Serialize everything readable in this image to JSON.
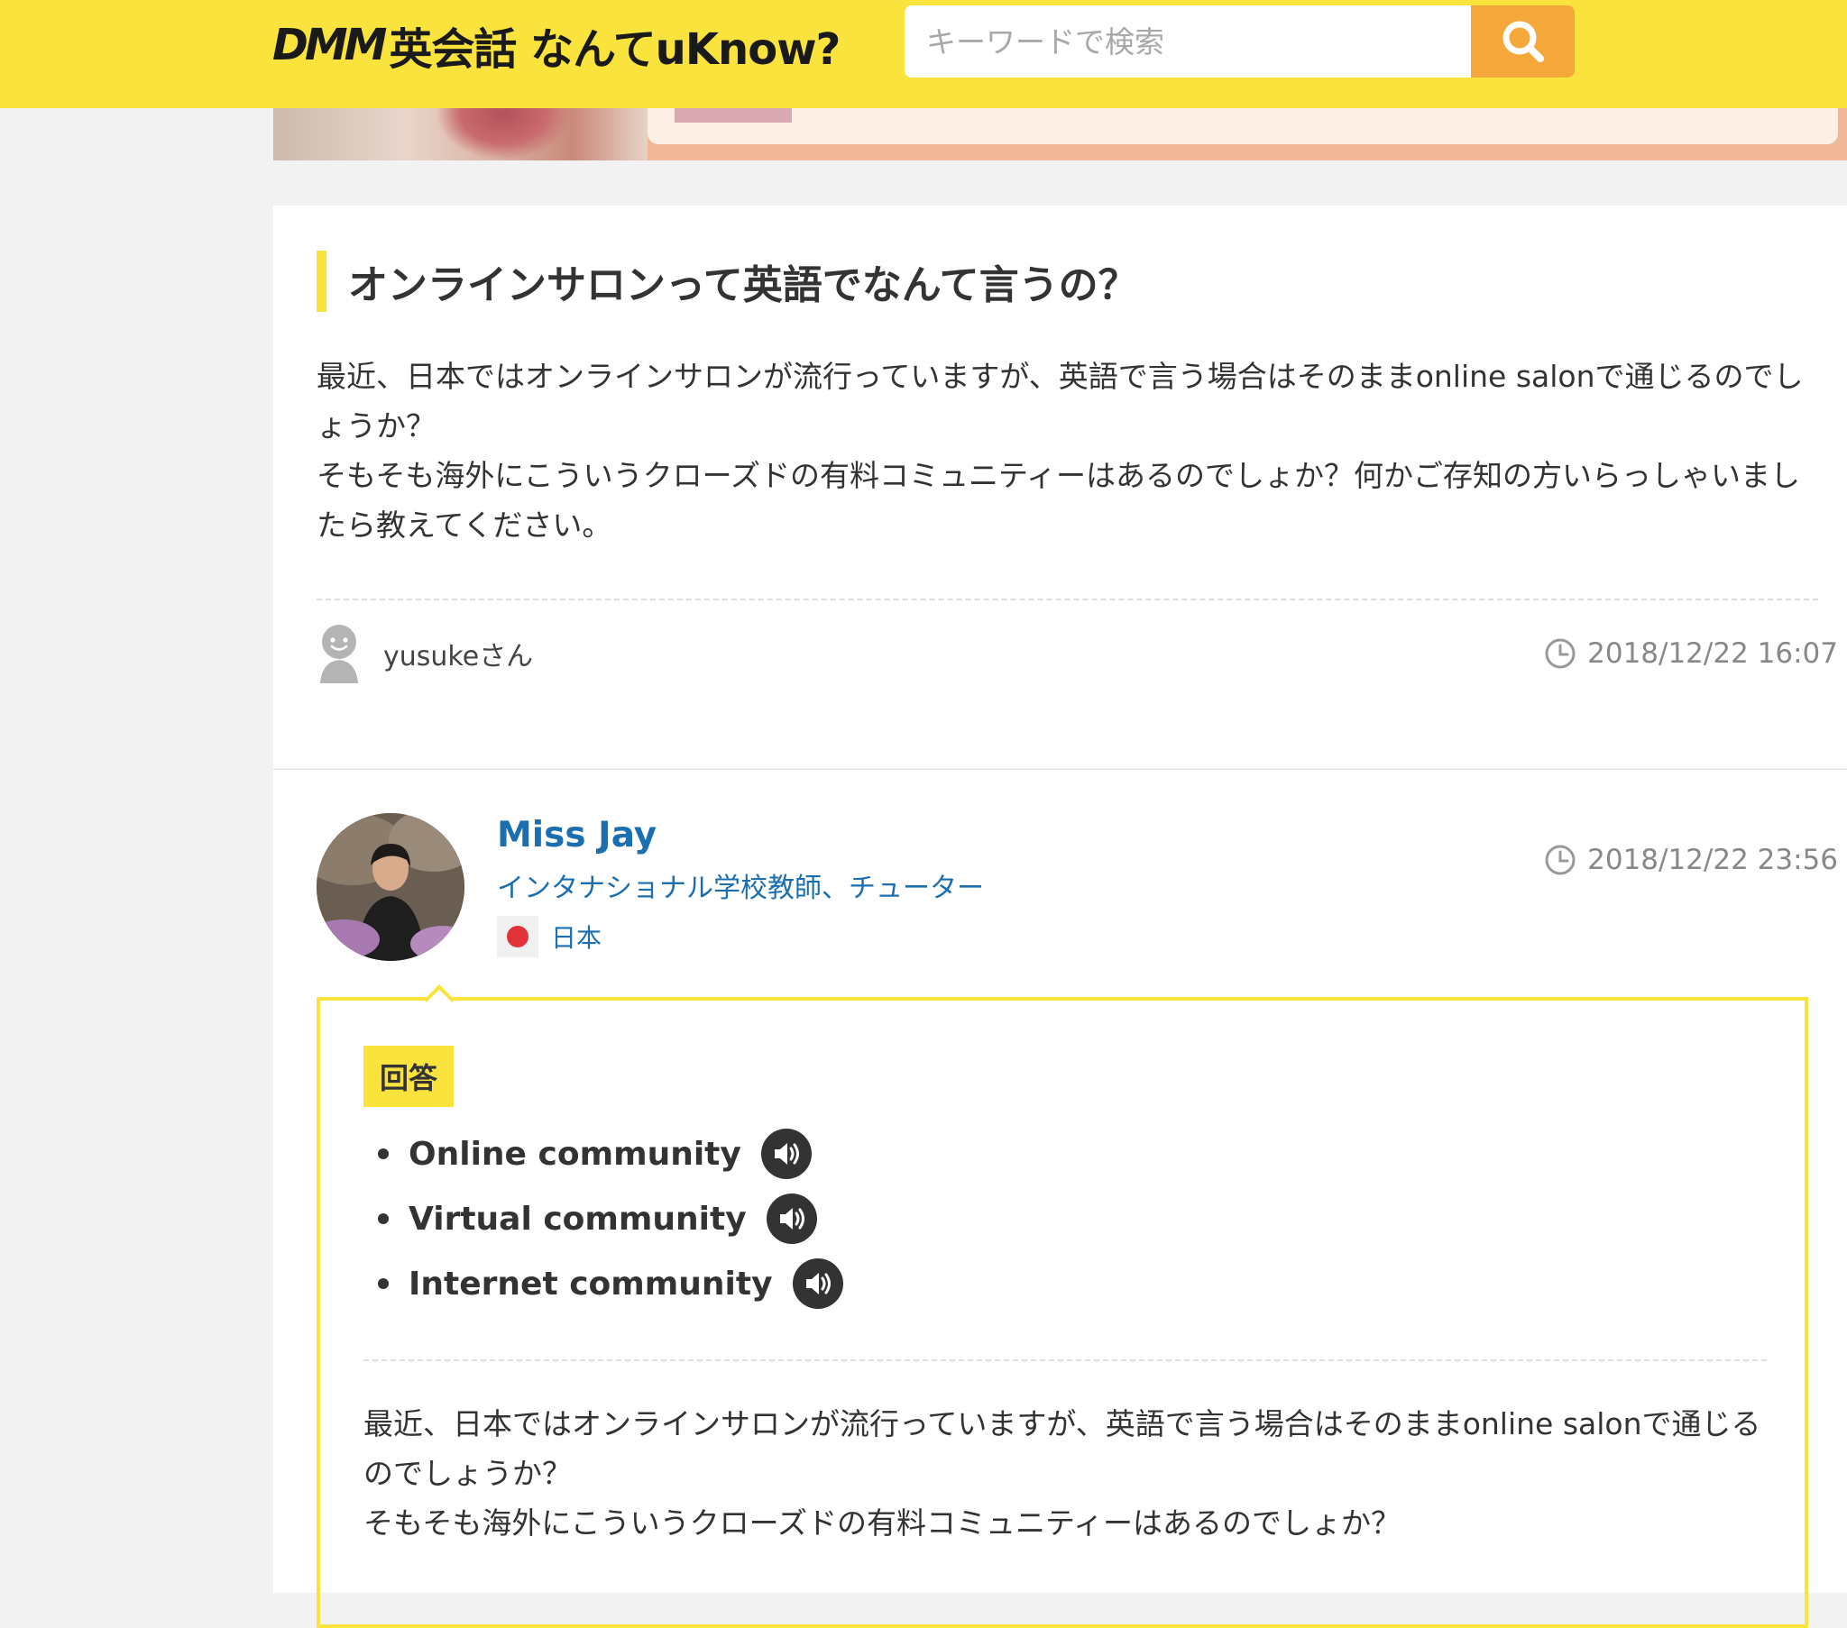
{
  "header": {
    "logo": {
      "brand": "DMM",
      "tail": "英会話 なんてuKnow?"
    },
    "search": {
      "placeholder": "キーワードで検索"
    }
  },
  "question": {
    "title": "オンラインサロンって英語でなんて言うの？",
    "body": [
      "最近、日本ではオンラインサロンが流行っていますが、英語で言う場合はそのままonline salonで通じるのでしょうか？",
      "そもそも海外にこういうクローズドの有料コミュニティーはあるのでしょか？何かご存知の方いらっしゃいましたら教えてください。"
    ],
    "asker": "yusukeさん",
    "timestamp": "2018/12/22 16:07"
  },
  "answer": {
    "answerer": {
      "name": "Miss Jay",
      "title": "インタナショナル学校教師、チューター",
      "country": "日本"
    },
    "timestamp": "2018/12/22 23:56",
    "badge": "回答",
    "phrases": [
      "Online community",
      "Virtual community",
      "Internet community"
    ],
    "body": [
      "最近、日本ではオンラインサロンが流行っていますが、英語で言う場合はそのままonline salonで通じるのでしょうか？",
      "そもそも海外にこういうクローズドの有料コミュニティーはあるのでしょか？"
    ]
  },
  "colors": {
    "header_bg": "#fbe33d",
    "search_button": "#f5a83a",
    "accent_blue": "#1b6fb0",
    "flag_red": "#e2333b"
  },
  "icons": [
    "search-icon",
    "user-icon",
    "clock-icon",
    "speaker-icon",
    "flag-japan-icon"
  ]
}
